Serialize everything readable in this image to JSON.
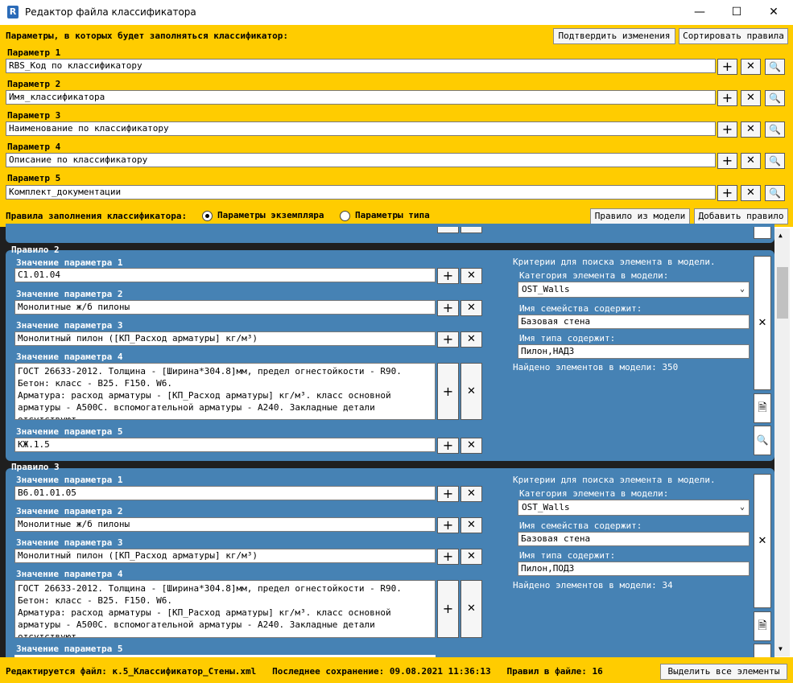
{
  "window": {
    "title": "Редактор файла классификатора",
    "app_icon": "R",
    "minimize_icon": "—",
    "maximize_icon": "☐",
    "close_icon": "✕"
  },
  "header": {
    "params_title": "Параметры, в которых будет заполняться классификатор:",
    "confirm_button": "Подтвердить изменения",
    "sort_button": "Сортировать правила",
    "params": [
      {
        "label": "Параметр 1",
        "value": "RBS_Код по классификатору"
      },
      {
        "label": "Параметр 2",
        "value": "Имя_классификатора"
      },
      {
        "label": "Параметр 3",
        "value": "Наименование по классификатору"
      },
      {
        "label": "Параметр 4",
        "value": "Описание по классификатору"
      },
      {
        "label": "Параметр 5",
        "value": "Комплект_документации"
      }
    ],
    "rules_label": "Правила заполнения классификатора:",
    "radio_instance": "Параметры экземпляра",
    "radio_type": "Параметры типа",
    "rule_from_model_button": "Правило из модели",
    "add_rule_button": "Добавить правило"
  },
  "icons": {
    "plus": "+",
    "cross": "✕",
    "search": "🔍",
    "doc": "🗎",
    "chevron": "⌄"
  },
  "rules": [
    {
      "title": "Правило 2",
      "p1_label": "Значение параметра 1",
      "p1": "C1.01.04",
      "p2_label": "Значение параметра 2",
      "p2": "Монолитные ж/б пилоны",
      "p3_label": "Значение параметра 3",
      "p3": "Монолитный пилон ([КП_Расход арматуры] кг/м³)",
      "p4_label": "Значение параметра 4",
      "p4": "ГОСТ 26633-2012. Толщина - [Ширина*304.8]мм, предел огнестойкости - R90.\nБетон: класс - В25. F150. W6.\nАрматура: расход арматуры - [КП_Расход арматуры] кг/м³. класс основной\nарматуры - А500С. вспомогательной арматуры - А240. Закладные детали\nотсутствуют.",
      "p5_label": "Значение параметра 5",
      "p5": "КЖ.1.5",
      "criteria_title": "Критерии для поиска элемента в модели.",
      "category_label": "Категория элемента в модели:",
      "category": "OST_Walls",
      "family_label": "Имя семейства содержит:",
      "family": "Базовая стена",
      "type_label": "Имя типа содержит:",
      "type": "Пилон,НАДЗ",
      "found": "Найдено элементов в модели: 350"
    },
    {
      "title": "Правило 3",
      "p1_label": "Значение параметра 1",
      "p1": "B6.01.01.05",
      "p2_label": "Значение параметра 2",
      "p2": "Монолитные ж/б пилоны",
      "p3_label": "Значение параметра 3",
      "p3": "Монолитный пилон ([КП_Расход арматуры] кг/м³)",
      "p4_label": "Значение параметра 4",
      "p4": "ГОСТ 26633-2012. Толщина - [Ширина*304.8]мм, предел огнестойкости - R90.\nБетон: класс - В25. F150. W6.\nАрматура: расход арматуры - [КП_Расход арматуры] кг/м³. класс основной\nарматуры - А500С. вспомогательной арматуры - А240. Закладные детали\nотсутствуют.",
      "p5_label": "Значение параметра 5",
      "criteria_title": "Критерии для поиска элемента в модели.",
      "category_label": "Категория элемента в модели:",
      "category": "OST_Walls",
      "family_label": "Имя семейства содержит:",
      "family": "Базовая стена",
      "type_label": "Имя типа содержит:",
      "type": "Пилон,ПОДЗ",
      "found": "Найдено элементов в модели: 34"
    }
  ],
  "footer": {
    "status": "Редактируется файл: к.5_Классификатор_Стены.xml   Последнее сохранение: 09.08.2021 11:36:13   Правил в файле: 16",
    "select_all_button": "Выделить все элементы"
  },
  "colors": {
    "accent": "#ffcc00",
    "panel": "#4682b4",
    "background": "#1f1f1f"
  }
}
